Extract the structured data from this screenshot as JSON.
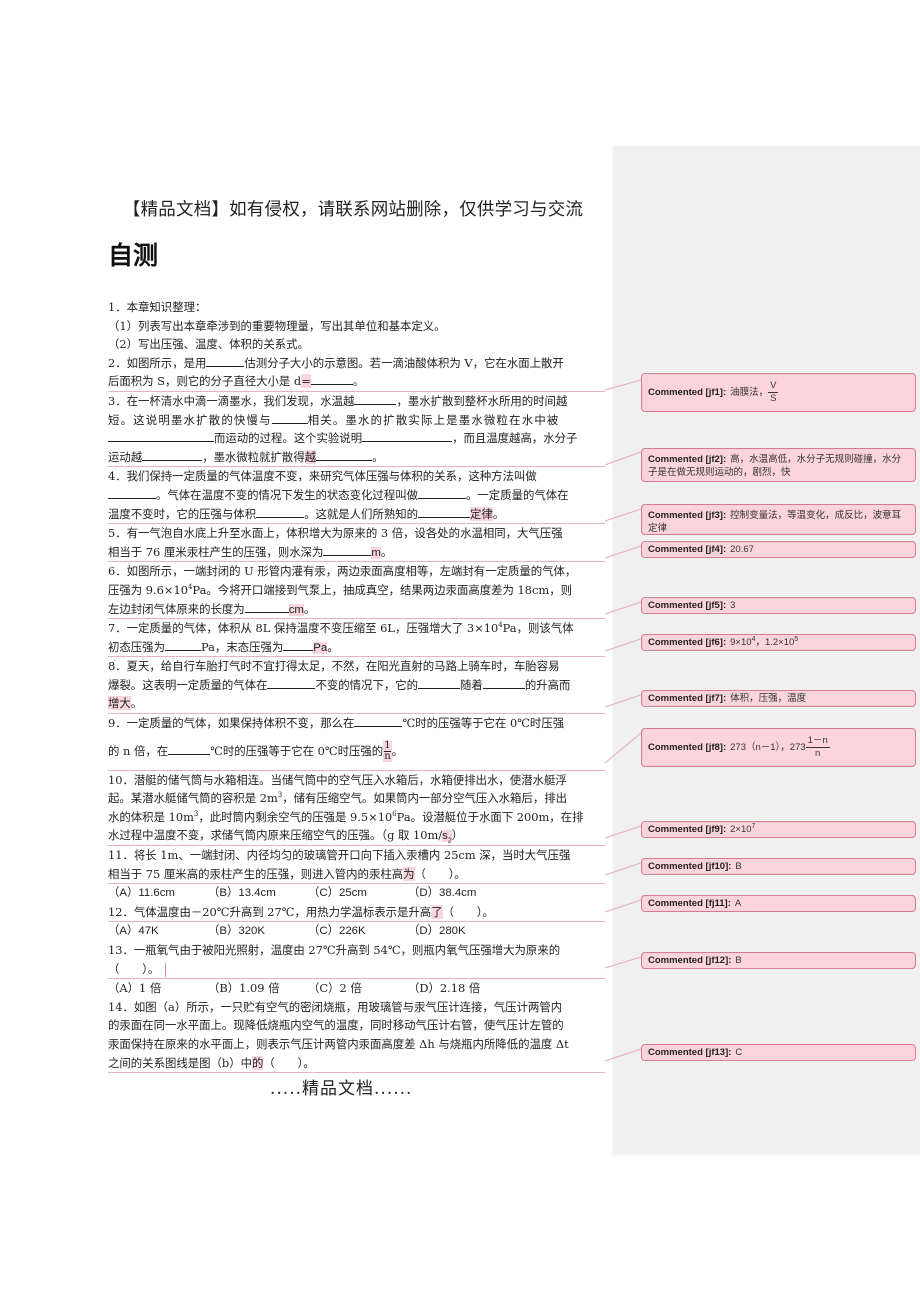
{
  "header_banner": "【精品文档】如有侵权，请联系网站删除，仅供学习与交流",
  "title": "自测",
  "footer_banner": ".....精品文档......",
  "questions": {
    "q1": {
      "l1": "1．本章知识整理：",
      "l2": "（1）列表写出本章牵涉到的重要物理量，写出其单位和基本定义。",
      "l3": "（2）写出压强、温度、体积的关系式。"
    },
    "q2": {
      "l1a": "2．如图所示，是用",
      "l1b": "估测分子大小的示意图。若一滴油酸体积为 V，它在水面上散开",
      "l2a": "后面积为 S，则它的分子直径大小是 d",
      "l2hl": "=",
      "l2b": "。"
    },
    "q3": {
      "l1a": "3．在一杯清水中滴一滴墨水，我们发现，水温越",
      "l1b": "，墨水扩散到整杯水所用的时间越",
      "l2a": "短。这说明墨水扩散的快慢与",
      "l2b": "相关。墨水的扩散实际上是墨水微粒在水中被",
      "l3a": "而运动的过程。这个实验说明",
      "l3b": "，而且温度越高，水分子",
      "l4a": "运动越",
      "l4b": "，墨水微粒就扩散得",
      "l4hl": "越",
      "l4c": "。"
    },
    "q4": {
      "l1": "4．我们保持一定质量的气体温度不变，来研究气体压强与体积的关系，这种方法叫做",
      "l2a": "。气体在温度不变的情况下发生的状态变化过程叫做",
      "l2b": "。一定质量的气体在",
      "l3a": "温度不变时，它的压强与体积",
      "l3b": "。这就是人们所熟知的",
      "l3hl": "定律",
      "l3c": "。"
    },
    "q5": {
      "l1": "5．有一气泡自水底上升至水面上，体积增大为原来的 3 倍，设各处的水温相同，大气压强",
      "l2a": "相当于 76 厘米汞柱产生的压强，则水深为",
      "l2hl": "m",
      "l2b": "。"
    },
    "q6": {
      "l1": "6．如图所示，一端封闭的 U 形管内灌有汞，两边汞面高度相等，左端封有一定质量的气体，",
      "l2a": "压强为 9.6×10",
      "l2sup": "4",
      "l2b": "Pa。今将开口端接到气泵上，抽成真空，结果两边汞面高度差为 18cm，则",
      "l3a": "左边封闭气体原来的长度为",
      "l3hl": "cm",
      "l3b": "。"
    },
    "q7": {
      "l1a": "7．一定质量的气体，体积从 8L 保持温度不变压缩至 6L，压强增大了 3×10",
      "l1sup": "4",
      "l1b": "Pa，则该气体",
      "l2a": "初态压强为",
      "l2b": "Pa，末态压强为",
      "l2hl": "Pa",
      "l2c": "。"
    },
    "q8": {
      "l1": "8．夏天，给自行车胎打气时不宜打得太足，不然，在阳光直射的马路上骑车时，车胎容易",
      "l2a": "爆裂。这表明一定质量的气体在",
      "l2b": "不变的情况下，它的",
      "l2c": "随着",
      "l2d": "的升高而",
      "l3hl": "增大",
      "l3b": "。"
    },
    "q9": {
      "l1a": "9．一定质量的气体，如果保持体积不变，那么在",
      "l1b": "℃时的压强等于它在 0℃时压强",
      "l2a": "的 n 倍，在",
      "l2b": "℃时的压强等于它在 0℃时压强的",
      "frac_num": "1",
      "frac_den": "n",
      "l2c": "。"
    },
    "q10": {
      "l1": "10．潜艇的储气筒与水箱相连。当储气筒中的空气压入水箱后，水箱便排出水，使潜水艇浮",
      "l2a": "起。某潜水艇储气筒的容积是 2m",
      "l2sup": "3",
      "l2b": "，储有压缩空气。如果筒内一部分空气压入水箱后，排出",
      "l3a": "水的体积是 10m",
      "l3sup": "3",
      "l3b": "，此时筒内剩余空气的压强是 9.5×10",
      "l3sup2": "6",
      "l3c": "Pa。设潜艇位于水面下 200m，在排",
      "l4a": "水过程中温度不变，求储气筒内原来压缩空气的压强。（g 取 10m/",
      "l4hl": "s",
      "l4sub": "2",
      "l4b": "）"
    },
    "q11": {
      "l1": "11．将长 1m、一端封闭、内径均匀的玻璃管开口向下插入汞槽内 25cm 深，当时大气压强",
      "l2a": "相当于 75 厘米高的汞柱产生的压强，则进入管内的汞柱高",
      "l2hl": "为",
      "l2b": "（　　）。",
      "options": [
        "（A）11.6cm",
        "（B）13.4cm",
        "（C）25cm",
        "（D）38.4cm"
      ]
    },
    "q12": {
      "l1a": "12．气体温度由－20℃升高到 27℃，用热力学温标表示是升高",
      "l1hl": "了",
      "l1b": "（　　）。",
      "options": [
        "（A）47K",
        "（B）320K",
        "（C）226K",
        "（D）280K"
      ]
    },
    "q13": {
      "l1": "13．一瓶氧气由于被阳光照射，温度由 27℃升高到 54℃，则瓶内氧气压强增大为原来的",
      "l2": "（　　）。",
      "options": [
        "（A）1 倍",
        "（B）1.09 倍",
        "（C）2 倍",
        "（D）2.18 倍"
      ]
    },
    "q14": {
      "l1": "14．如图（a）所示，一只贮有空气的密闭烧瓶，用玻璃管与汞气压计连接，气压计两管内",
      "l2": "的汞面在同一水平面上。现降低烧瓶内空气的温度，同时移动气压计右管，使气压计左管的",
      "l3": "汞面保持在原来的水平面上，则表示气压计两管内汞面高度差 Δh 与烧瓶内所降低的温度 Δt",
      "l4a": "之间的关系图线是图（b）中",
      "l4hl": "的",
      "l4b": "（　　）。"
    }
  },
  "comments": [
    {
      "label": "Commented [jf1]:",
      "text": "油膜法，",
      "frac_num": "V",
      "frac_den": "S"
    },
    {
      "label": "Commented [jf2]:",
      "text": "高，水温高低，水分子无规则碰撞，水分子是在做无规则运动的，剧烈，快"
    },
    {
      "label": "Commented [jf3]:",
      "text": "控制变量法，等温变化，成反比，波意耳定律"
    },
    {
      "label": "Commented [jf4]:",
      "text": "20.67"
    },
    {
      "label": "Commented [jf5]:",
      "text": "3"
    },
    {
      "label": "Commented [jf6]:",
      "text_a": "9×10",
      "sup_a": "4",
      "text_b": "，1.2×10",
      "sup_b": "5"
    },
    {
      "label": "Commented [jf7]:",
      "text": "体积，压强，温度"
    },
    {
      "label": "Commented [jf8]:",
      "text": "273（n－1），273",
      "frac_num": "1－n",
      "frac_den": "n"
    },
    {
      "label": "Commented [jf9]:",
      "text_a": "2×10",
      "sup_a": "7"
    },
    {
      "label": "Commented [jf10]:",
      "text": "B"
    },
    {
      "label": "Commented [fj11]:",
      "text": "A"
    },
    {
      "label": "Commented [jf12]:",
      "text": "B"
    },
    {
      "label": "Commented [jf13]:",
      "text": "C"
    }
  ],
  "colors": {
    "comment_fill": "#fbd4dd",
    "comment_border": "#d77b93",
    "highlight": "#f9d5de",
    "pane_background": "#f0f0f0"
  }
}
